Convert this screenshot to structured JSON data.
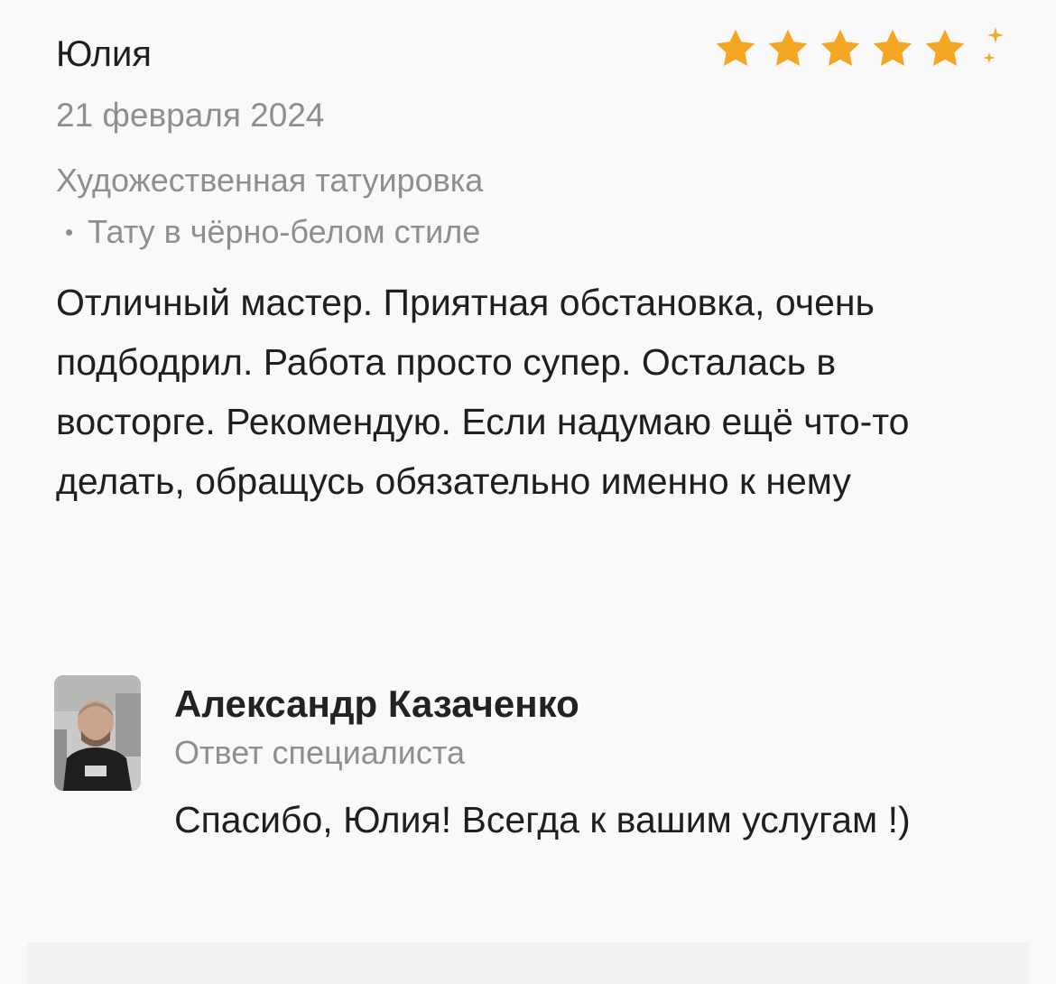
{
  "review": {
    "author": "Юлия",
    "rating": 5,
    "star_color": "#f5a623",
    "date": "21 февраля 2024",
    "service_category": "Художественная татуировка",
    "service_subitem": "Тату в чёрно-белом стиле",
    "text": "Отличный мастер. Приятная обстановка, очень подбодрил. Работа просто супер. Осталась в восторге. Рекомендую. Если надумаю ещё что-то делать, обращусь обязательно именно к нему"
  },
  "reply": {
    "author": "Александр Казаченко",
    "role": "Ответ специалиста",
    "text": "Спасибо, Юлия! Всегда к вашим услугам !)",
    "avatar_icon": "specialist-avatar"
  },
  "icons": {
    "star": "star-icon",
    "bullet": "•"
  }
}
